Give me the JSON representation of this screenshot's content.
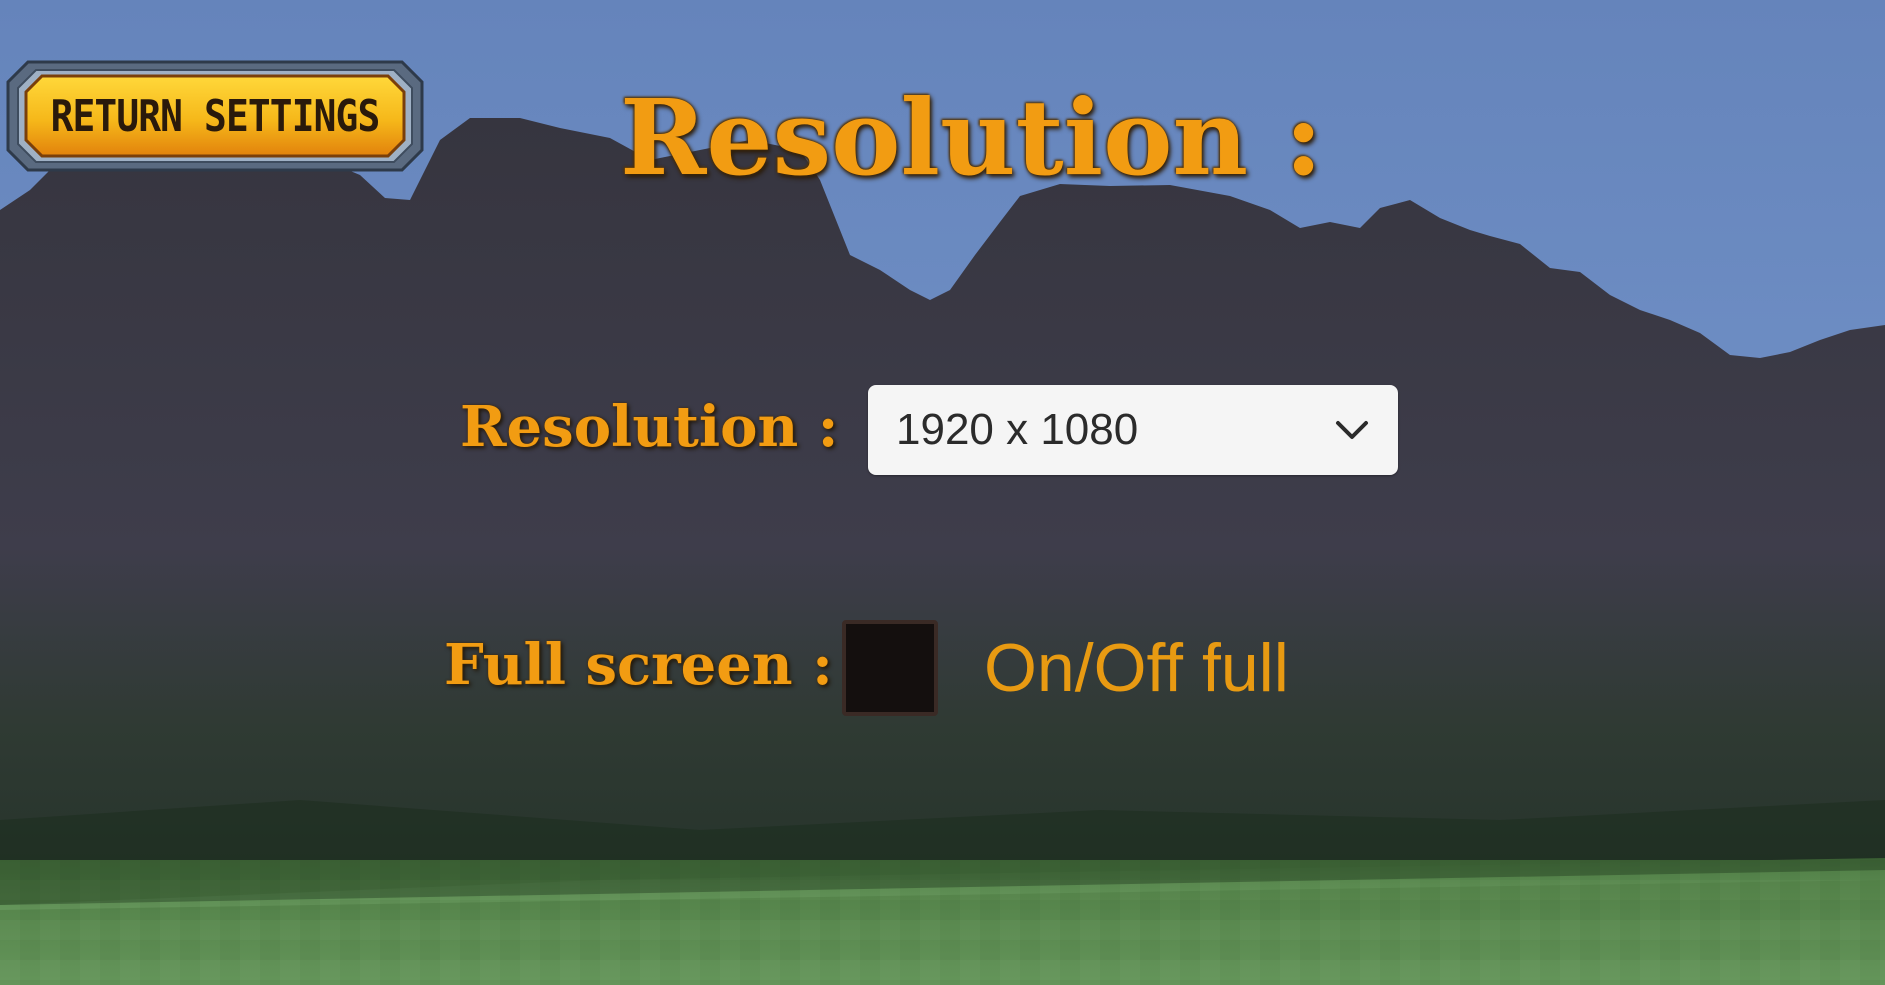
{
  "header": {
    "return_button_label": "RETURN SETTINGS",
    "title": "Resolution :"
  },
  "settings": {
    "resolution_label": "Resolution :",
    "resolution_value": "1920 x 1080",
    "fullscreen_label": "Full screen :",
    "fullscreen_checked": false,
    "fullscreen_toggle_text": "On/Off full"
  },
  "colors": {
    "accent_text": "#f29c12",
    "button_fill": "#f6c11b",
    "sky": "#6a88bd",
    "mountain": "#3b3a48",
    "grass": "#5b8a4c"
  },
  "icons": {
    "dropdown": "chevron-down-icon"
  }
}
